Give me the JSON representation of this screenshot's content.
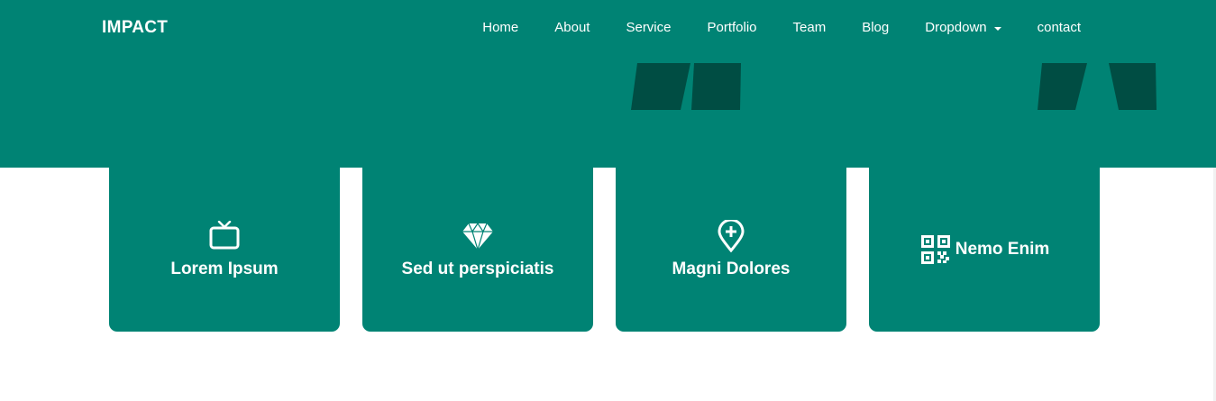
{
  "brand": {
    "name": "IMPACT"
  },
  "nav": {
    "items": [
      {
        "label": "Home"
      },
      {
        "label": "About"
      },
      {
        "label": "Service"
      },
      {
        "label": "Portfolio"
      },
      {
        "label": "Team"
      },
      {
        "label": "Blog"
      },
      {
        "label": "Dropdown"
      },
      {
        "label": "contact"
      }
    ]
  },
  "cards": [
    {
      "title": "Lorem Ipsum",
      "icon": "tv-icon"
    },
    {
      "title": "Sed ut perspiciatis",
      "icon": "gem-icon"
    },
    {
      "title": "Magni Dolores",
      "icon": "geo-plus-icon"
    },
    {
      "title": "Nemo Enim",
      "icon": "qr-code-icon"
    }
  ],
  "colors": {
    "primary": "#008374",
    "deco_dark": "#004d43",
    "text": "#ffffff",
    "background": "#ffffff"
  }
}
